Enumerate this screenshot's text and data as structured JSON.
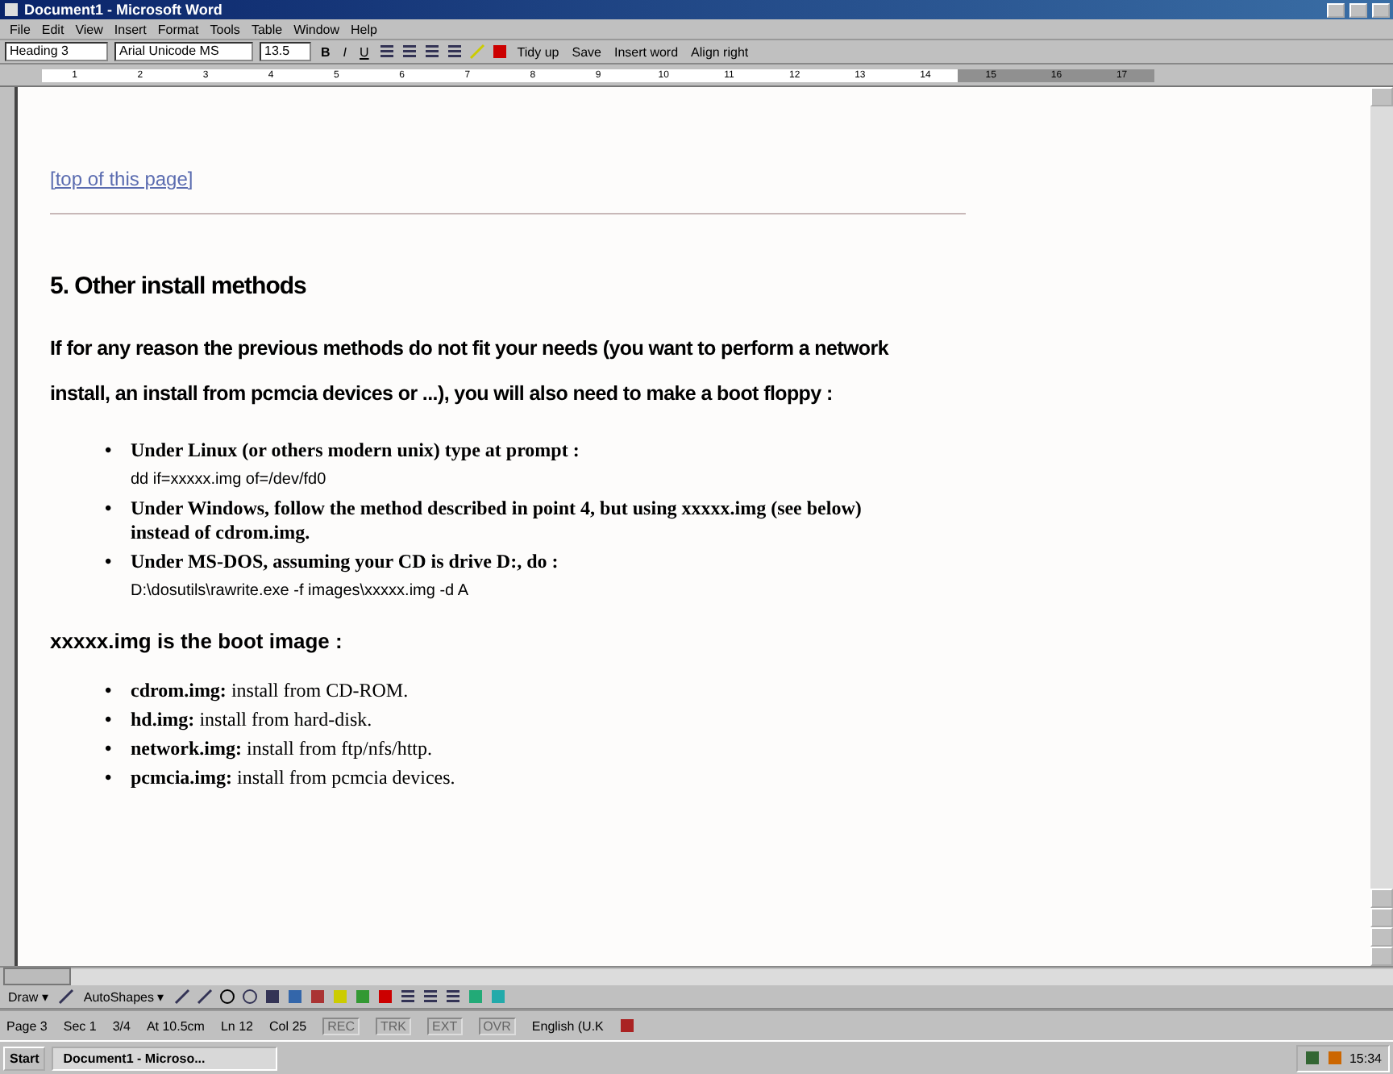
{
  "window": {
    "title": "Document1 - Microsoft Word"
  },
  "menu": [
    "File",
    "Edit",
    "View",
    "Insert",
    "Format",
    "Tools",
    "Table",
    "Window",
    "Help"
  ],
  "format_toolbar": {
    "style": "Heading 3",
    "font": "Arial Unicode MS",
    "size": "13.5",
    "bold": "B",
    "italic": "I",
    "underline": "U",
    "actions": [
      "Tidy up",
      "Save",
      "Insert word",
      "Align right"
    ]
  },
  "ruler": {
    "numbers": [
      "1",
      "2",
      "3",
      "4",
      "5",
      "6",
      "7",
      "8",
      "9",
      "10",
      "11",
      "12",
      "13",
      "14",
      "15",
      "16",
      "17"
    ]
  },
  "document": {
    "link": "[top of this page]",
    "heading": "5. Other install methods",
    "intro": "If for any reason the previous methods do not fit your needs (you want to perform a network install, an install from pcmcia devices or ...), you will also need to make a boot floppy :",
    "methods": [
      {
        "bullet": "•",
        "text": "Under Linux (or others modern unix) type at prompt :",
        "command": "dd if=xxxxx.img of=/dev/fd0"
      },
      {
        "bullet": "•",
        "text": "Under Windows, follow the method described in point 4, but using xxxxx.img (see below) instead of cdrom.img."
      },
      {
        "bullet": "•",
        "text": "Under MS-DOS, assuming your CD is drive D:, do :",
        "command": "D:\\dosutils\\rawrite.exe -f images\\xxxxx.img -d A"
      }
    ],
    "images_heading": "xxxxx.img **is the boot image :**",
    "images": [
      {
        "bullet": "•",
        "text": "**cdrom.img:** install from CD-ROM."
      },
      {
        "bullet": "•",
        "text": "**hd.img:** install from hard-disk."
      },
      {
        "bullet": "•",
        "text": "**network.img:** install from ftp/nfs/http."
      },
      {
        "bullet": "•",
        "text": "**pcmcia.img:** install from pcmcia devices."
      }
    ]
  },
  "drawing_toolbar": {
    "draw": "Draw ▾",
    "autoshapes": "AutoShapes ▾"
  },
  "status_bar": [
    "Page 3",
    "Sec 1",
    "3/4",
    "At 10.5cm",
    "Ln 12",
    "Col 25"
  ],
  "status_modes": [
    {
      "label": "REC",
      "on": false
    },
    {
      "label": "TRK",
      "on": false
    },
    {
      "label": "EXT",
      "on": false
    },
    {
      "label": "OVR",
      "on": false
    }
  ],
  "language": "English (U.K",
  "taskbar": {
    "start": "Start",
    "task": "Document1 - Microso...",
    "clock": "15:34"
  }
}
